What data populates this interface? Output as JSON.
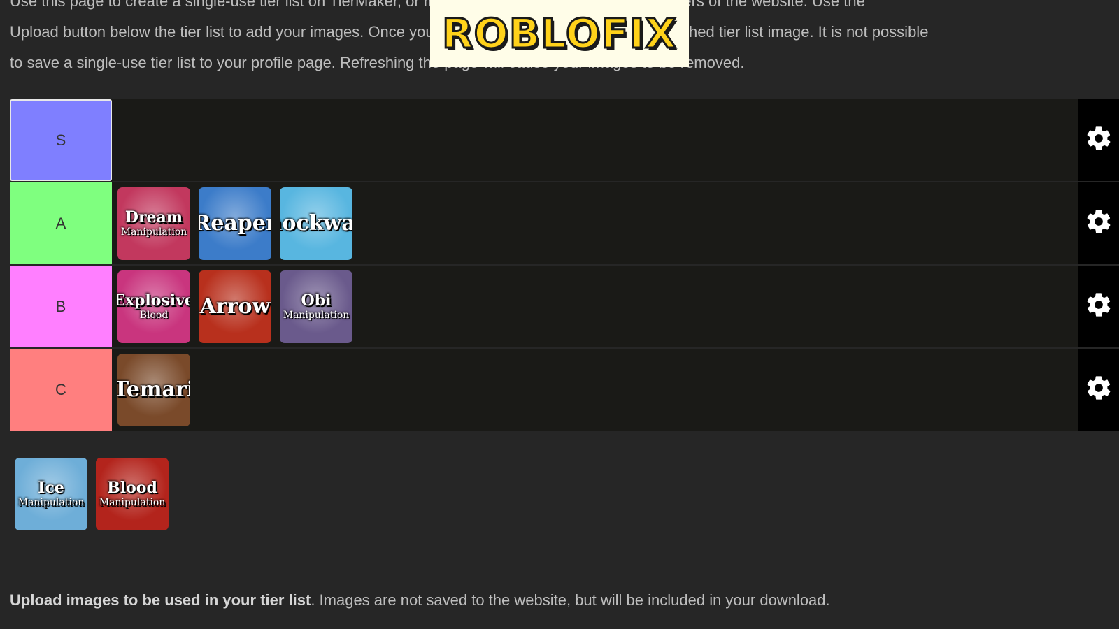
{
  "intro_lines": [
    "Use this page to create a single-use tier list on TierMaker, or make a reusable template for other users of the website. Use the",
    "Upload button below the tier list to add your images. Once you are done, you can download the finished tier list image. It is not possible",
    "to save a single-use tier list to your profile page. Refreshing the page will cause your images to be removed."
  ],
  "watermark": "ROBLOFIX",
  "tiers": [
    {
      "label": "S",
      "color": "#7f7fff",
      "items": []
    },
    {
      "label": "A",
      "color": "#7fff7f",
      "items": [
        {
          "line1": "Dream",
          "line2": "Manipulation",
          "bg": "#c2385e"
        },
        {
          "line1": "Reaper",
          "line2": "",
          "bg": "#3c7cc9"
        },
        {
          "line1": "Shockwave",
          "line2": "",
          "bg": "#58b6e0"
        }
      ]
    },
    {
      "label": "B",
      "color": "#ff7fff",
      "items": [
        {
          "line1": "Explosive",
          "line2": "Blood",
          "bg": "#c9357e"
        },
        {
          "line1": "Arrow",
          "line2": "",
          "bg": "#b8301d"
        },
        {
          "line1": "Obi",
          "line2": "Manipulation",
          "bg": "#6a5a8c"
        }
      ]
    },
    {
      "label": "C",
      "color": "#ff7f7f",
      "items": [
        {
          "line1": "Temari",
          "line2": "",
          "bg": "#7a4a2a"
        }
      ]
    }
  ],
  "pool_items": [
    {
      "line1": "Ice",
      "line2": "Manipulation",
      "bg": "#6eaed8"
    },
    {
      "line1": "Blood",
      "line2": "Manipulation",
      "bg": "#b3241c"
    }
  ],
  "footer": {
    "bold": "Upload images to be used in your tier list",
    "rest": ". Images are not saved to the website, but will be included in your download."
  },
  "icons": {
    "settings": "gear-icon"
  }
}
